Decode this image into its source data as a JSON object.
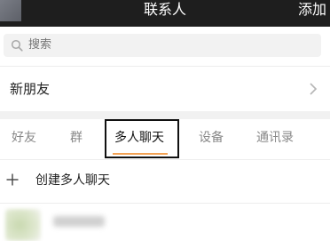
{
  "header": {
    "title": "联系人",
    "add_label": "添加"
  },
  "search": {
    "placeholder": "搜索"
  },
  "new_friends": {
    "label": "新朋友"
  },
  "tabs": [
    {
      "label": "好友",
      "active": false
    },
    {
      "label": "群",
      "active": false
    },
    {
      "label": "多人聊天",
      "active": true
    },
    {
      "label": "设备",
      "active": false
    },
    {
      "label": "通讯录",
      "active": false
    }
  ],
  "create_group": {
    "label": "创建多人聊天"
  },
  "colors": {
    "accent": "#f3a254",
    "topbar": "#1e1e1e"
  }
}
